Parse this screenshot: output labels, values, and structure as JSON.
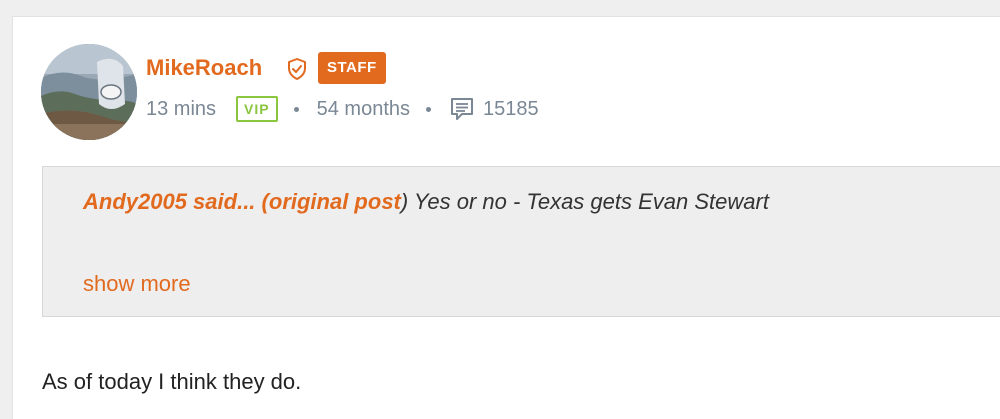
{
  "post": {
    "username": "MikeRoach",
    "staff_label": "STAFF",
    "time": "13 mins",
    "vip_label": "VIP",
    "membership": "54 months",
    "post_count": "15185",
    "quote": {
      "author": "Andy2005 said...",
      "open_paren": "(",
      "link_text": "original post",
      "close_paren": ")",
      "text": " Yes or no - Texas gets Evan Stewart",
      "show_more": "show more"
    },
    "body": "As of today I think they do."
  },
  "icons": {
    "avatar": "user-avatar",
    "shield": "shield-check-icon",
    "comment": "comment-icon"
  },
  "colors": {
    "accent": "#e26a1f",
    "vip": "#8cc63f",
    "meta_text": "#7a8794"
  }
}
